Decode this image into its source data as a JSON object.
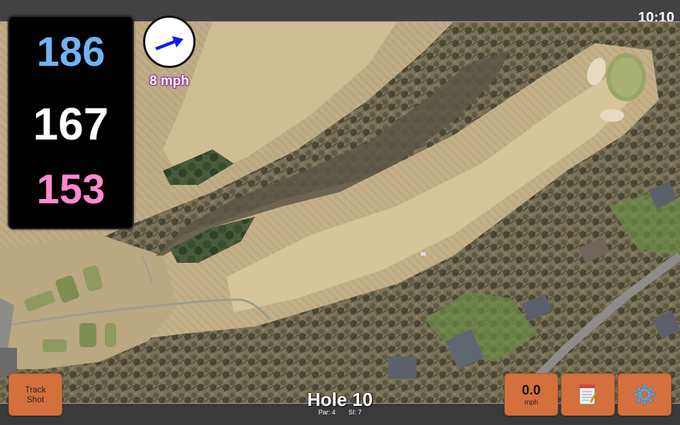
{
  "status_bar": {
    "time": "10:10"
  },
  "distances": {
    "back": "186",
    "middle": "167",
    "front": "153",
    "colors": {
      "back": "#6fb4f5",
      "middle": "#ffffff",
      "front": "#ff88cc"
    }
  },
  "wind": {
    "indicator_icon": "wind-arrow-icon",
    "speed_label": "8 mph",
    "arrow_color": "#0d1fe0"
  },
  "buttons": {
    "track_shot_line1": "Track",
    "track_shot_line2": "Shot",
    "shot_speed_value": "0.0",
    "shot_speed_unit": "mph",
    "notes_icon": "notepad-icon",
    "settings_icon": "gear-icon"
  },
  "hole": {
    "title": "Hole 10",
    "par_label": "Par: 4",
    "si_label": "SI: 7"
  },
  "map": {
    "features": [
      "fairway",
      "green",
      "bunkers",
      "tee-boxes",
      "trees",
      "cart-path",
      "road",
      "houses"
    ]
  },
  "colors": {
    "button_orange": "#d4703c",
    "panel_black": "#000000",
    "bar_gray": "#424242",
    "wind_label_outline": "#9a2f9a"
  }
}
